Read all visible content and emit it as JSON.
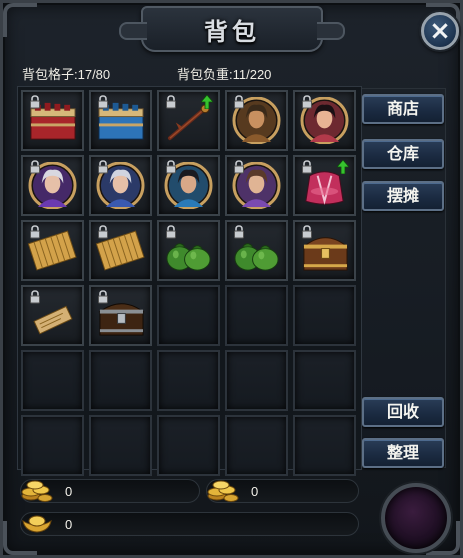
{
  "window": {
    "title": "背包",
    "close_icon": "×"
  },
  "stats": {
    "slots_label": "背包格子:17/80",
    "weight_label": "背包负重:11/220"
  },
  "side_buttons": [
    {
      "label": "商店"
    },
    {
      "label": "仓库"
    },
    {
      "label": "摆摊"
    },
    {
      "label": "回收"
    },
    {
      "label": "整理"
    }
  ],
  "inventory": [
    {
      "icon": "red-chest-icon",
      "locked": true,
      "upgrade": false
    },
    {
      "icon": "blue-chest-icon",
      "locked": true,
      "upgrade": false
    },
    {
      "icon": "staff-weapon-icon",
      "locked": true,
      "upgrade": true
    },
    {
      "icon": "hero-portrait-warrior-icon",
      "locked": true,
      "upgrade": false
    },
    {
      "icon": "hero-portrait-heroine-icon",
      "locked": true,
      "upgrade": false
    },
    {
      "icon": "hero-portrait-sage-icon",
      "locked": true,
      "upgrade": false
    },
    {
      "icon": "hero-portrait-sage-blue-icon",
      "locked": true,
      "upgrade": false
    },
    {
      "icon": "hero-portrait-archer-icon",
      "locked": true,
      "upgrade": false
    },
    {
      "icon": "hero-portrait-scholar-icon",
      "locked": true,
      "upgrade": false
    },
    {
      "icon": "robe-armor-icon",
      "locked": true,
      "upgrade": true
    },
    {
      "icon": "bamboo-scroll-icon",
      "locked": true,
      "upgrade": false
    },
    {
      "icon": "bamboo-scroll-icon",
      "locked": true,
      "upgrade": false
    },
    {
      "icon": "green-pouch-icon",
      "locked": true,
      "upgrade": false
    },
    {
      "icon": "green-pouch-icon",
      "locked": true,
      "upgrade": false
    },
    {
      "icon": "treasure-chest-gold-icon",
      "locked": true,
      "upgrade": false
    },
    {
      "icon": "letter-scroll-icon",
      "locked": true,
      "upgrade": false
    },
    {
      "icon": "treasure-chest-wood-icon",
      "locked": true,
      "upgrade": false
    }
  ],
  "total_slots": 30,
  "currency": {
    "gold": {
      "icon": "gold-coins-icon",
      "value": "0"
    },
    "bound_gold": {
      "icon": "gold-coins-icon",
      "value": "0"
    },
    "ingot": {
      "icon": "gold-ingot-icon",
      "value": "0"
    }
  },
  "colors": {
    "accent": "#2a3d57",
    "frame": "#3a4047",
    "lock": "#c8ccd0",
    "upgrade": "#36c22e"
  }
}
